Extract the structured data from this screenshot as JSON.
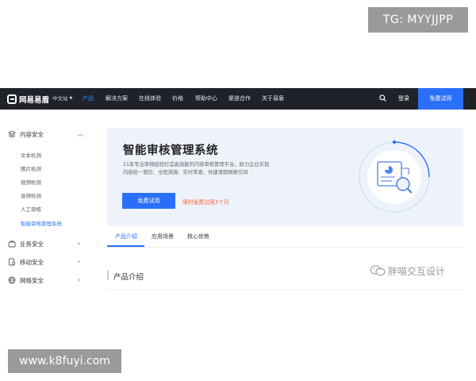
{
  "watermark_top": "TG: MYYJJPP",
  "watermark_bottom": "www.k8fuyi.com",
  "navbar": {
    "logo_text": "网易易盾",
    "lang": "中文站",
    "items": [
      {
        "label": "产品",
        "active": true
      },
      {
        "label": "解决方案",
        "active": false
      },
      {
        "label": "在线体验",
        "active": false
      },
      {
        "label": "价格",
        "active": false
      },
      {
        "label": "帮助中心",
        "active": false
      },
      {
        "label": "渠道合作",
        "active": false
      },
      {
        "label": "关于易盾",
        "active": false
      }
    ],
    "login": "登录",
    "trial": "免费试用"
  },
  "sidebar": {
    "groups": [
      {
        "label": "内容安全",
        "icon": "layers-icon",
        "expanded": true,
        "items": [
          "文本检测",
          "图片检测",
          "视频检测",
          "音频检测",
          "人工审核",
          "智能审核管理系统"
        ],
        "active_item": "智能审核管理系统"
      },
      {
        "label": "业务安全",
        "icon": "briefcase-icon",
        "expanded": false
      },
      {
        "label": "移动安全",
        "icon": "mobile-shield-icon",
        "expanded": false
      },
      {
        "label": "网络安全",
        "icon": "globe-icon",
        "expanded": false
      }
    ]
  },
  "banner": {
    "title": "智能审核管理系统",
    "desc_line1": "21年专业审核经验打造高效能的内容审核管理平台，助力企业实现",
    "desc_line2": "内容统一管控、全程溯源、实时审查，共建清朗网络空间",
    "button": "免费试用",
    "promo": "限时免费试用3个月"
  },
  "tabs": [
    {
      "label": "产品介绍",
      "active": true
    },
    {
      "label": "应用场景",
      "active": false
    },
    {
      "label": "核心优势",
      "active": false
    }
  ],
  "section_title": "产品介绍",
  "wechat_watermark": "胖喵交互设计",
  "colors": {
    "accent": "#2a6ff7",
    "nav_bg": "#1f2329",
    "promo": "#f0663a",
    "banner_bg": "#eef3fb"
  }
}
